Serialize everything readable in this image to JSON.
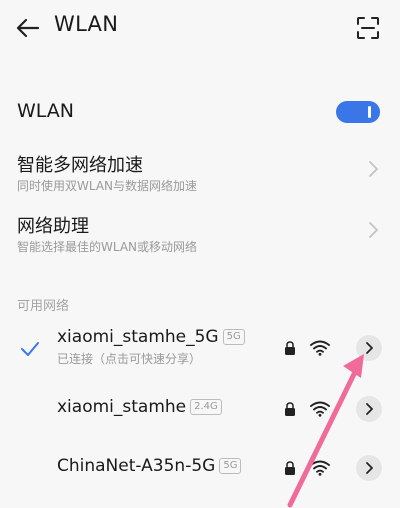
{
  "header": {
    "title": "WLAN",
    "back_icon": "arrow-left-icon",
    "scan_icon": "scan-frame-icon"
  },
  "wlan_toggle": {
    "label": "WLAN",
    "state": "on",
    "accent": "#3a76e8"
  },
  "settings": [
    {
      "title": "智能多网络加速",
      "subtitle": "同时使用双WLAN与数据网络加速"
    },
    {
      "title": "网络助理",
      "subtitle": "智能选择最佳的WLAN或移动网络"
    }
  ],
  "available_header": "可用网络",
  "networks": [
    {
      "name": "xiaomi_stamhe_5G",
      "band": "5G",
      "status": "已连接（点击可快速分享）",
      "connected": true
    },
    {
      "name": "xiaomi_stamhe",
      "band": "2.4G",
      "status": "",
      "connected": false
    },
    {
      "name": "ChinaNet-A35n-5G",
      "band": "5G",
      "status": "",
      "connected": false
    }
  ],
  "annotation_color": "#f06a9a"
}
